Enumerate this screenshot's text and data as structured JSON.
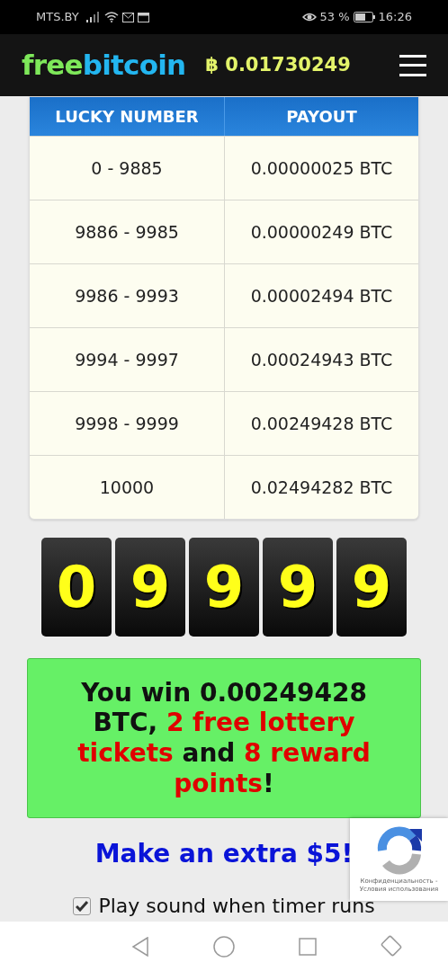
{
  "status_bar": {
    "carrier": "MTS.BY",
    "battery": "53 %",
    "time": "16:26"
  },
  "header": {
    "logo_first": "free",
    "logo_second": "bitcoin",
    "balance_symbol": "฿",
    "balance": "0.01730249"
  },
  "table": {
    "columns": [
      "LUCKY NUMBER",
      "PAYOUT"
    ],
    "rows": [
      [
        "0 - 9885",
        "0.00000025 BTC"
      ],
      [
        "9886 - 9985",
        "0.00000249 BTC"
      ],
      [
        "9986 - 9993",
        "0.00002494 BTC"
      ],
      [
        "9994 - 9997",
        "0.00024943 BTC"
      ],
      [
        "9998 - 9999",
        "0.00249428 BTC"
      ],
      [
        "10000",
        "0.02494282 BTC"
      ]
    ]
  },
  "digits": [
    "0",
    "9",
    "9",
    "9",
    "9"
  ],
  "win_message": [
    {
      "kind": "plain",
      "text": "You win 0.00249428 BTC, "
    },
    {
      "kind": "highlight",
      "text": "2 free lottery tickets"
    },
    {
      "kind": "plain",
      "text": " and "
    },
    {
      "kind": "highlight",
      "text": "8 reward points"
    },
    {
      "kind": "plain",
      "text": "!"
    }
  ],
  "promo": "Make an extra $5!",
  "sound_option": {
    "label": "Play sound when timer runs",
    "checked": true
  },
  "recaptcha": {
    "privacy": "Конфиденциальность -",
    "terms": "Условия использования"
  }
}
